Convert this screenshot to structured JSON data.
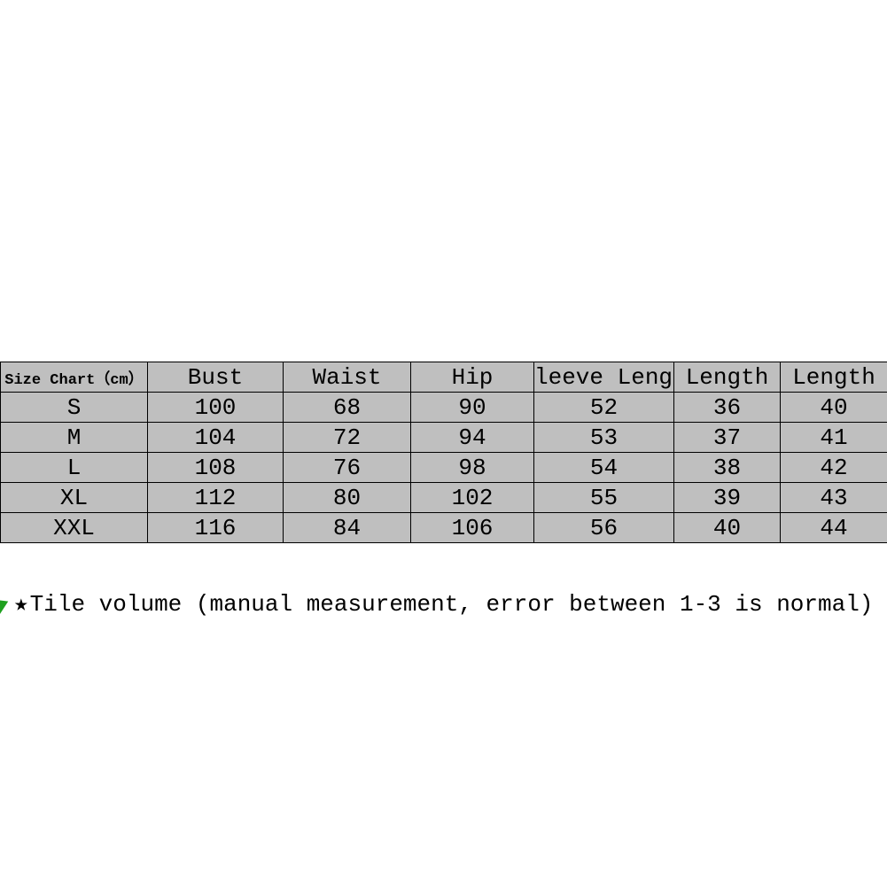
{
  "chart_data": {
    "type": "table",
    "title": "Size Chart（cm）",
    "headers": [
      "Size Chart（cm）",
      "Bust",
      "Waist",
      "Hip",
      "leeve Lengt",
      "Length",
      "Length"
    ],
    "rows": [
      {
        "size": "S",
        "bust": 100,
        "waist": 68,
        "hip": 90,
        "sleeve_length": 52,
        "length1": 36,
        "length2": 40
      },
      {
        "size": "M",
        "bust": 104,
        "waist": 72,
        "hip": 94,
        "sleeve_length": 53,
        "length1": 37,
        "length2": 41
      },
      {
        "size": "L",
        "bust": 108,
        "waist": 76,
        "hip": 98,
        "sleeve_length": 54,
        "length1": 38,
        "length2": 42
      },
      {
        "size": "XL",
        "bust": 112,
        "waist": 80,
        "hip": 102,
        "sleeve_length": 55,
        "length1": 39,
        "length2": 43
      },
      {
        "size": "XXL",
        "bust": 116,
        "waist": 84,
        "hip": 106,
        "sleeve_length": 56,
        "length1": 40,
        "length2": 44
      }
    ]
  },
  "note": {
    "star": "★",
    "text": "Tile volume (manual measurement, error between 1-3 is normal)"
  }
}
